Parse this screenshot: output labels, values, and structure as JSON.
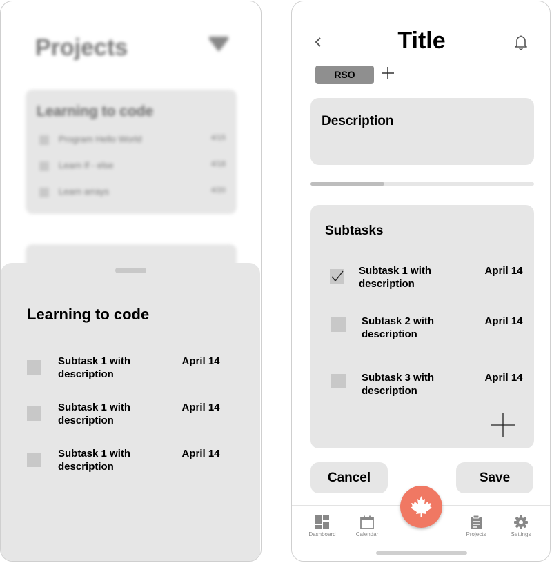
{
  "left_screen": {
    "background": {
      "title": "Projects",
      "card_title": "Learning to code",
      "rows": [
        {
          "label": "Program Hello World",
          "date": "4/15"
        },
        {
          "label": "Learn If - else",
          "date": "4/18"
        },
        {
          "label": "Learn arrays",
          "date": "4/20"
        }
      ]
    },
    "sheet": {
      "title": "Learning to code",
      "subtasks": [
        {
          "label": "Subtask 1 with description",
          "date": "April 14"
        },
        {
          "label": "Subtask 1 with description",
          "date": "April 14"
        },
        {
          "label": "Subtask 1 with description",
          "date": "April 14"
        }
      ]
    }
  },
  "right_screen": {
    "title": "Title",
    "tag": "RSO",
    "description_label": "Description",
    "progress": 0.33,
    "subtasks_title": "Subtasks",
    "subtasks": [
      {
        "label": "Subtask 1 with description",
        "date": "April 14",
        "checked": true
      },
      {
        "label": "Subtask 2 with description",
        "date": "April 14",
        "checked": false
      },
      {
        "label": "Subtask 3 with description",
        "date": "April 14",
        "checked": false
      }
    ],
    "cancel_label": "Cancel",
    "save_label": "Save",
    "tabs": [
      {
        "label": "Dashboard",
        "icon": "dashboard-icon"
      },
      {
        "label": "Calendar",
        "icon": "calendar-icon"
      },
      {
        "label": "Projects",
        "icon": "clipboard-icon"
      },
      {
        "label": "Settings",
        "icon": "gear-icon"
      }
    ],
    "fab_icon": "maple-leaf-icon"
  },
  "colors": {
    "accent": "#f07863",
    "card": "#e6e6e6",
    "checkbox": "#c8c8c8",
    "tag": "#8f8f8f"
  }
}
